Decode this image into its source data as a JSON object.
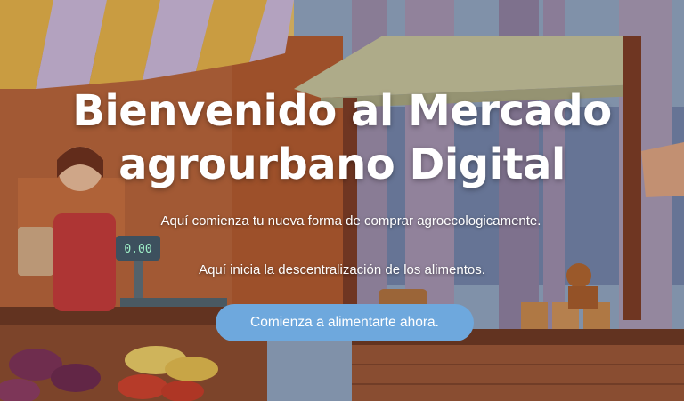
{
  "hero": {
    "title_line1": "Bienvenido al Mercado",
    "title_line2": "agrourbano Digital",
    "subtitle1": "Aquí comienza tu nueva forma de comprar agroecologicamente.",
    "subtitle2": "Aquí inicia la descentralización de los alimentos.",
    "cta_label": "Comienza a alimentarte ahora.",
    "scale_display": "0.00"
  },
  "colors": {
    "cta_background": "#6ea8dd",
    "text": "#ffffff",
    "awning_yellow": "#e8b64a",
    "awning_lilac": "#c9b8df",
    "wood": "#8a4b2e",
    "sky": "#8fa9c9"
  }
}
